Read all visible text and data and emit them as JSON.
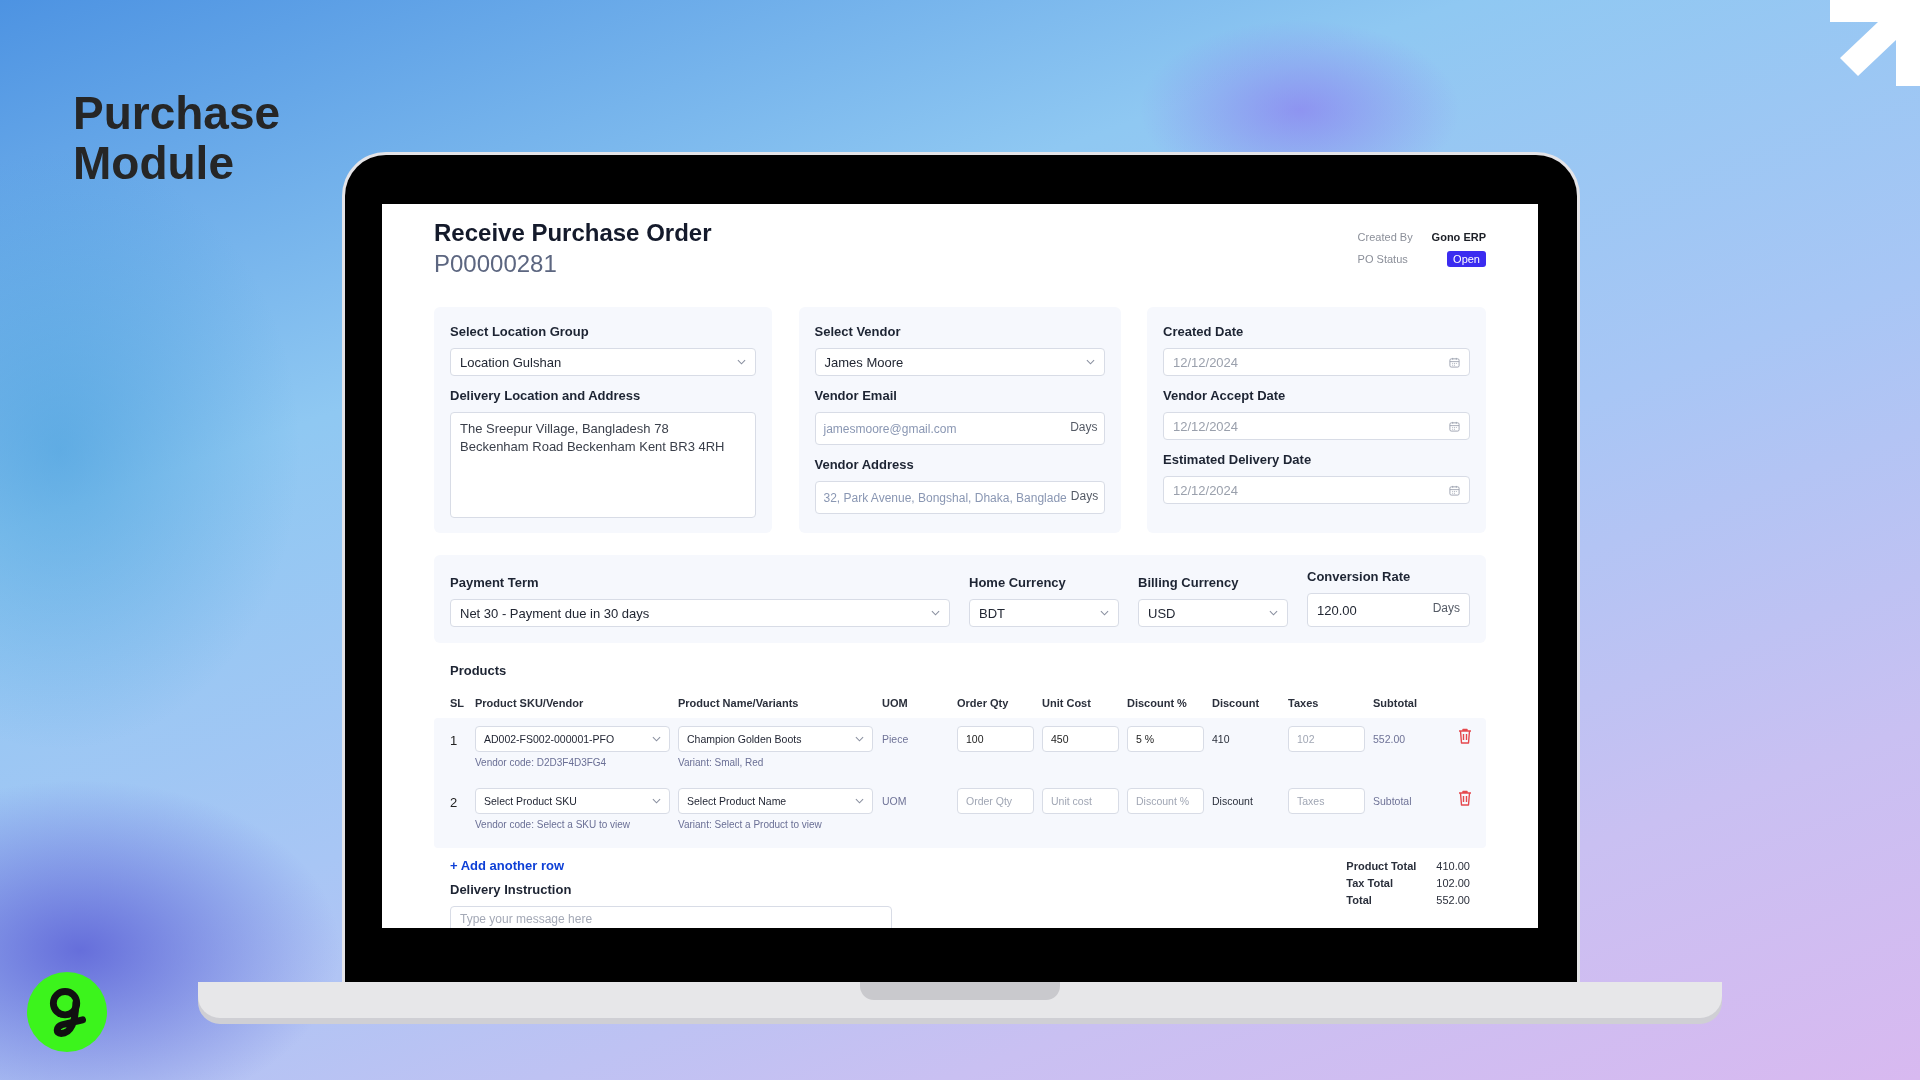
{
  "headline": "Purchase Module",
  "page": {
    "title": "Receive Purchase Order",
    "po_number": "P00000281",
    "meta": [
      {
        "label": "Created By",
        "value": "Gono ERP",
        "kind": "text"
      },
      {
        "label": "PO Status",
        "value": "Open",
        "kind": "badge"
      }
    ]
  },
  "cards": [
    {
      "fields": [
        {
          "label": "Select Location Group",
          "kind": "select",
          "value": "Location Gulshan"
        },
        {
          "label": "Delivery Location and Address",
          "kind": "textarea",
          "value": "The Sreepur Village, Bangladesh 78\nBeckenham Road Beckenham Kent BR3 4RH"
        }
      ]
    },
    {
      "fields": [
        {
          "label": "Select Vendor",
          "kind": "select",
          "value": "James Moore"
        },
        {
          "label": "Vendor Email",
          "kind": "readonly",
          "value": "jamesmoore@gmail.com",
          "suffix": "Days"
        },
        {
          "label": "Vendor Address",
          "kind": "readonly",
          "value": "32, Park Avenue, Bongshal, Dhaka, Banglade",
          "suffix": "Days"
        }
      ]
    },
    {
      "fields": [
        {
          "label": "Created Date",
          "kind": "date",
          "value": "12/12/2024"
        },
        {
          "label": "Vendor Accept Date",
          "kind": "date",
          "value": "12/12/2024"
        },
        {
          "label": "Estimated Delivery Date",
          "kind": "date",
          "value": "12/12/2024"
        }
      ]
    }
  ],
  "payment": [
    {
      "label": "Payment Term",
      "kind": "select",
      "value": "Net 30 - Payment due in 30 days"
    },
    {
      "label": "Home Currency",
      "kind": "select",
      "value": "BDT"
    },
    {
      "label": "Billing Currency",
      "kind": "select",
      "value": "USD"
    },
    {
      "label": "Conversion Rate",
      "kind": "input",
      "value": "120.00",
      "suffix": "Days"
    }
  ],
  "products": {
    "title": "Products",
    "columns": [
      "SL",
      "Product SKU/Vendor",
      "Product Name/Variants",
      "UOM",
      "Order Qty",
      "Unit Cost",
      "Discount %",
      "Discount",
      "Taxes",
      "Subtotal"
    ],
    "rows": [
      {
        "sl": "1",
        "sku": "AD002-FS002-000001-PFO",
        "vendor_code": "Vendor code: D2D3F4D3FG4",
        "product": "Champion Golden Boots",
        "variant": "Variant: Small, Red",
        "uom": "Piece",
        "order_qty": {
          "value": "100"
        },
        "unit_cost": {
          "value": "450"
        },
        "discount_pct": {
          "value": "5 %"
        },
        "discount": "410",
        "taxes": {
          "value": "102"
        },
        "subtotal": "552.00"
      },
      {
        "sl": "2",
        "sku": "Select Product SKU",
        "vendor_code": "Vendor code: Select a SKU to view",
        "product": "Select Product Name",
        "variant": "Variant: Select a Product to view",
        "uom": "UOM",
        "order_qty": {
          "placeholder": "Order Qty"
        },
        "unit_cost": {
          "placeholder": "Unit cost"
        },
        "discount_pct": {
          "placeholder": "Discount %"
        },
        "discount": "Discount",
        "taxes": {
          "placeholder": "Taxes"
        },
        "subtotal": "Subtotal"
      }
    ]
  },
  "add_row": "+ Add another row",
  "delivery_instruction": {
    "label": "Delivery Instruction",
    "placeholder": "Type your message here"
  },
  "totals": [
    {
      "label": "Product Total",
      "value": "410.00"
    },
    {
      "label": "Tax Total",
      "value": "102.00"
    },
    {
      "label": "Total",
      "value": "552.00"
    }
  ]
}
